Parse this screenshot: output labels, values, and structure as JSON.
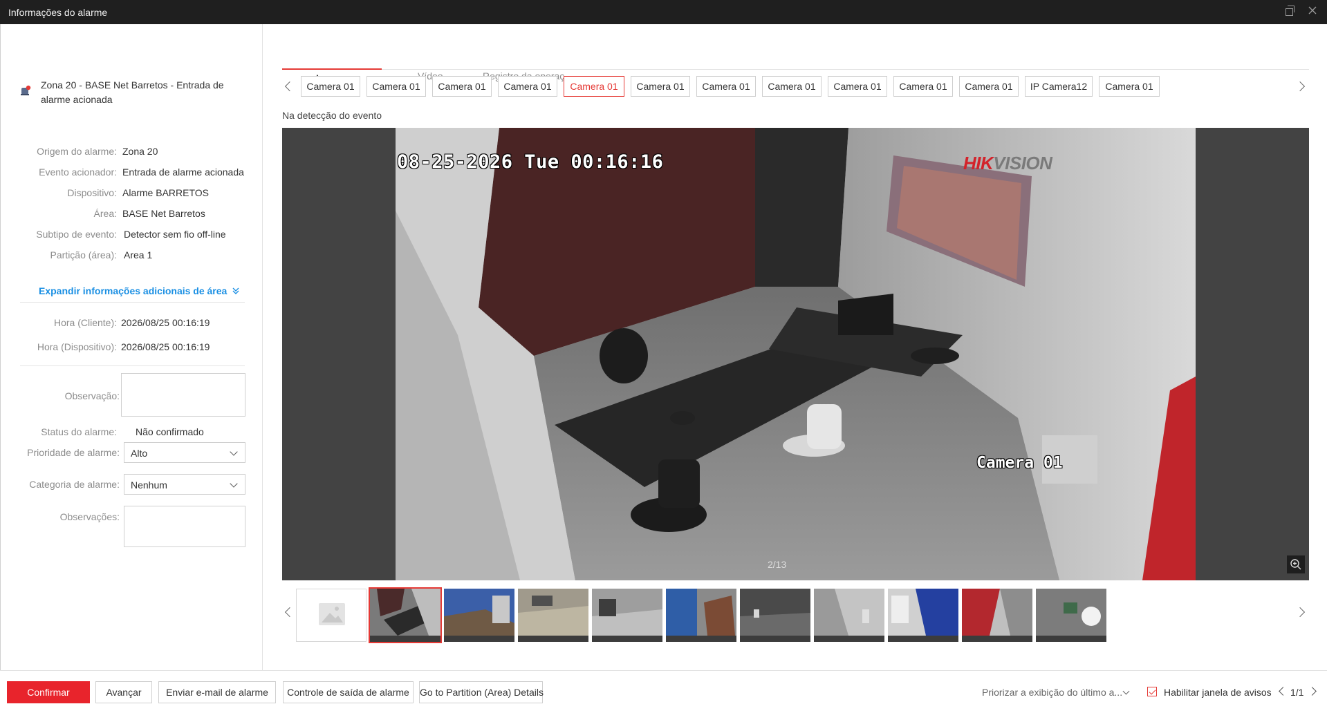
{
  "window": {
    "title": "Informações do alarme"
  },
  "alarm": {
    "title": "Zona 20 - BASE Net Barretos - Entrada de alarme acionada",
    "details": [
      {
        "label": "Origem do alarme:",
        "value": "Zona 20"
      },
      {
        "label": "Evento acionador:",
        "value": "Entrada de alarme acionada"
      },
      {
        "label": "Dispositivo:",
        "value": "Alarme BARRETOS"
      },
      {
        "label": "Área:",
        "value": "BASE Net Barretos"
      },
      {
        "label": "Subtipo de evento:",
        "value": "Detector sem fio off-line"
      },
      {
        "label": "Partição (área):",
        "value": "Area 1"
      }
    ],
    "expand_label": "Expandir informações adicionais de área",
    "times": [
      {
        "label": "Hora (Cliente):",
        "value": "2026/08/25 00:16:19"
      },
      {
        "label": "Hora (Dispositivo):",
        "value": "2026/08/25 00:16:19"
      }
    ],
    "observation_label": "Observação:",
    "observation_value": "",
    "status_label": "Status do alarme:",
    "status_value": "Não confirmado",
    "priority_label": "Prioridade de alarme:",
    "priority_value": "Alto",
    "category_label": "Categoria de alarme:",
    "category_value": "Nenhum",
    "remarks_label": "Observações:",
    "remarks_value": ""
  },
  "tabs": [
    {
      "label": "Imagem",
      "active": true
    },
    {
      "label": "Vídeo",
      "active": false
    },
    {
      "label": "Registro da operaç...",
      "active": false
    }
  ],
  "cameras": [
    {
      "label": "Camera 01",
      "active": false
    },
    {
      "label": "Camera 01",
      "active": false
    },
    {
      "label": "Camera 01",
      "active": false
    },
    {
      "label": "Camera 01",
      "active": false
    },
    {
      "label": "Camera 01",
      "active": true
    },
    {
      "label": "Camera 01",
      "active": false
    },
    {
      "label": "Camera 01",
      "active": false
    },
    {
      "label": "Camera 01",
      "active": false
    },
    {
      "label": "Camera 01",
      "active": false
    },
    {
      "label": "Camera 01",
      "active": false
    },
    {
      "label": "Camera 01",
      "active": false
    },
    {
      "label": "IP Camera12",
      "active": false
    },
    {
      "label": "Camera 01",
      "active": false
    }
  ],
  "viewer": {
    "event_label": "Na detecção do evento",
    "osd_timestamp": "08-25-2026 Tue 00:16:16",
    "osd_camera": "Camera 01",
    "brand_red": "HIK",
    "brand_gray": "VISION",
    "counter": "2/13"
  },
  "footer": {
    "confirm": "Confirmar",
    "advance": "Avançar",
    "email": "Enviar e-mail de alarme",
    "output_control": "Controle de saída de alarme",
    "partition_details": "Go to Partition (Area) Details",
    "prioritize": "Priorizar a exibição do último a...",
    "enable_popup": "Habilitar janela de avisos",
    "page": "1/1"
  },
  "colors": {
    "accent": "#e53935",
    "link": "#1a8fe3",
    "titlebar": "#1f1f1f"
  }
}
